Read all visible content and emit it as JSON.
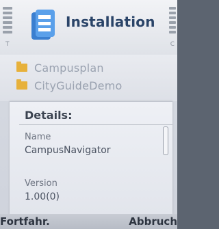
{
  "header": {
    "title": "Installation",
    "left_indicator": "T",
    "right_indicator": "C"
  },
  "list": {
    "items": [
      {
        "label": "Campusplan"
      },
      {
        "label": "CityGuideDemo"
      }
    ]
  },
  "details": {
    "title": "Details:",
    "name_label": "Name",
    "name_value": "CampusNavigator",
    "version_label": "Version",
    "version_value": "1.00(0)"
  },
  "softkeys": {
    "left": "Fortfahr.",
    "right": "Abbruch"
  },
  "colors": {
    "title": "#2a4468",
    "folder": "#e7b13b",
    "accent_icon": "#3a7fd0"
  }
}
